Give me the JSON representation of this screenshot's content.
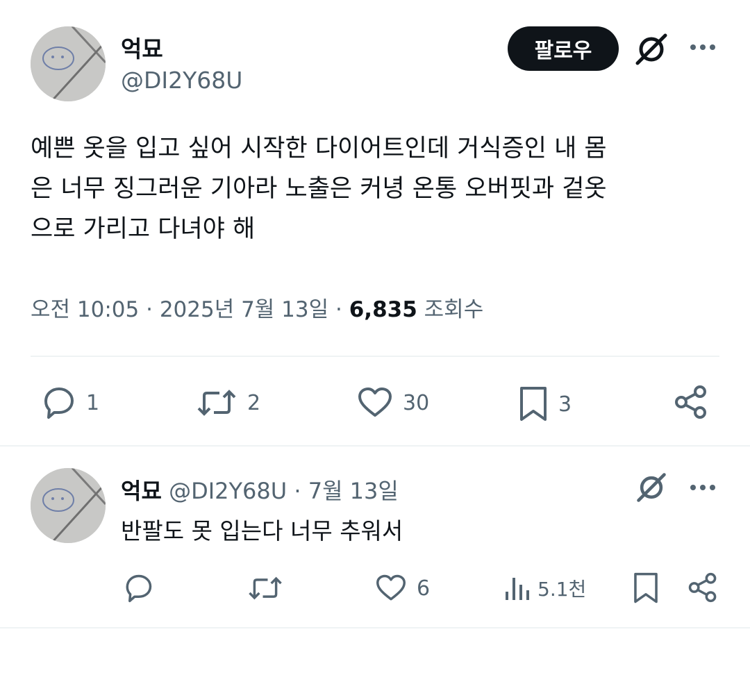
{
  "main_tweet": {
    "display_name": "억묘",
    "handle": "@DI2Y68U",
    "follow_label": "팔로우",
    "text_lines": [
      "예쁜 옷을 입고 싶어 시작한 다이어트인데 거식증인 내 몸",
      "은 너무 징그러운 기아라 노출은 커녕 온통 오버핏과 겉옷",
      "으로 가리고 다녀야 해"
    ],
    "time": "오전 10:05",
    "date": "2025년 7월 13일",
    "views_count": "6,835",
    "views_label": "조회수",
    "separator": "·",
    "actions": {
      "reply_count": "1",
      "retweet_count": "2",
      "like_count": "30",
      "bookmark_count": "3"
    }
  },
  "reply_tweet": {
    "display_name": "억묘",
    "handle": "@DI2Y68U",
    "date": "7월 13일",
    "separator": "·",
    "text": "반팔도 못 입는다 너무 추워서",
    "actions": {
      "like_count": "6",
      "views_count": "5.1천"
    }
  },
  "icons": {
    "more": "more-icon",
    "grok": "grok-icon",
    "reply": "reply-icon",
    "retweet": "retweet-icon",
    "like": "heart-icon",
    "bookmark": "bookmark-icon",
    "share": "share-icon",
    "views": "views-icon"
  },
  "colors": {
    "text": "#0f1419",
    "muted": "#536471",
    "divider": "#eff3f4",
    "button": "#0f1419"
  }
}
